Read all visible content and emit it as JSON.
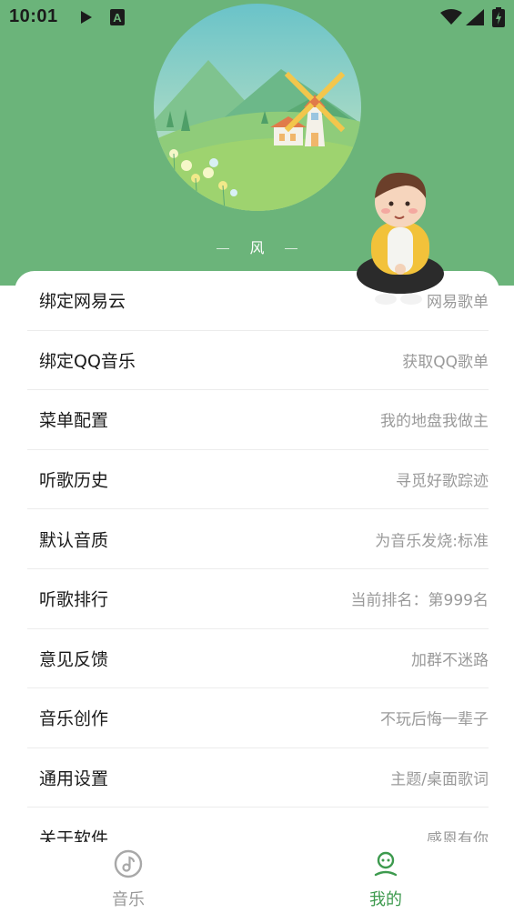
{
  "status_bar": {
    "time": "10:01",
    "icons": [
      "play-icon",
      "a-box-icon",
      "wifi-icon",
      "signal-icon",
      "battery-charging-icon"
    ]
  },
  "player": {
    "title": "风"
  },
  "menu": {
    "items": [
      {
        "label": "绑定网易云",
        "desc": "网易歌单"
      },
      {
        "label": "绑定QQ音乐",
        "desc": "获取QQ歌单"
      },
      {
        "label": "菜单配置",
        "desc": "我的地盘我做主"
      },
      {
        "label": "听歌历史",
        "desc": "寻觅好歌踪迹"
      },
      {
        "label": "默认音质",
        "desc": "为音乐发烧:标准"
      },
      {
        "label": "听歌排行",
        "desc": "当前排名：第999名"
      },
      {
        "label": "意见反馈",
        "desc": "加群不迷路"
      },
      {
        "label": "音乐创作",
        "desc": "不玩后悔一辈子"
      },
      {
        "label": "通用设置",
        "desc": "主题/桌面歌词"
      },
      {
        "label": "关于软件",
        "desc": "感恩有你"
      }
    ]
  },
  "bottom_nav": {
    "music_label": "音乐",
    "mine_label": "我的",
    "active": "mine"
  },
  "colors": {
    "header_green": "#6bb47a",
    "active_green": "#3d9a4e",
    "text_primary": "#1a1a1a",
    "text_secondary": "#9a9a9a"
  }
}
